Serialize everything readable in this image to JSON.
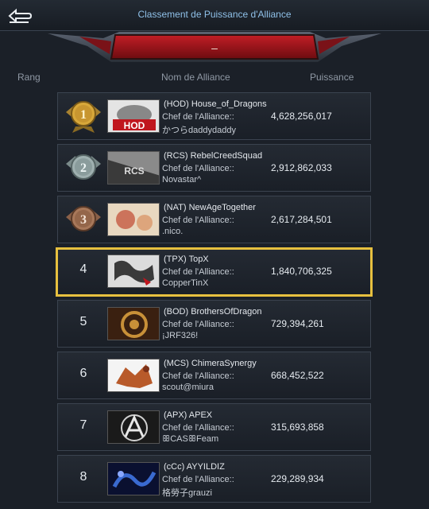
{
  "header": {
    "title": "Classement de Puissance d'Alliance",
    "banner_value": "–"
  },
  "columns": {
    "rank": "Rang",
    "name": "Nom de Alliance",
    "power": "Puissance"
  },
  "rows": [
    {
      "rank": "1",
      "line1": "(HOD) House_of_Dragons",
      "line2": "Chef de l'Alliance::",
      "line3": "かつらdaddydaddy",
      "power": "4,628,256,017"
    },
    {
      "rank": "2",
      "line1": "(RCS) RebelCreedSquad",
      "line2": "Chef de l'Alliance::",
      "line3": "Novastar^",
      "power": "2,912,862,033"
    },
    {
      "rank": "3",
      "line1": "(NAT) NewAgeTogether",
      "line2": "Chef de l'Alliance::",
      "line3": ".nico.",
      "power": "2,617,284,501"
    },
    {
      "rank": "4",
      "line1": "(TPX) TopX",
      "line2": "Chef de l'Alliance::",
      "line3": "CopperTinX",
      "power": "1,840,706,325"
    },
    {
      "rank": "5",
      "line1": "(BOD) BrothersOfDragon",
      "line2": "Chef de l'Alliance::",
      "line3": "¡JRF326!",
      "power": "729,394,261"
    },
    {
      "rank": "6",
      "line1": "(MCS) ChimeraSynergy",
      "line2": "Chef de l'Alliance::",
      "line3": "scout@miura",
      "power": "668,452,522"
    },
    {
      "rank": "7",
      "line1": "(APX) APEX",
      "line2": "Chef de l'Alliance::",
      "line3": "ꕥCASꕥFeam",
      "power": "315,693,858"
    },
    {
      "rank": "8",
      "line1": "(cCc) AYYILDIZ",
      "line2": "Chef de l'Alliance::",
      "line3": "格勞子grauzi",
      "power": "229,289,934"
    }
  ],
  "icons": {
    "back": "back-arrow-icon",
    "medals": [
      "gold-medal-icon",
      "silver-medal-icon",
      "bronze-medal-icon"
    ]
  },
  "colors": {
    "highlight": "#e7c03f",
    "title": "#8fc0e8",
    "banner": "#a0141c"
  }
}
